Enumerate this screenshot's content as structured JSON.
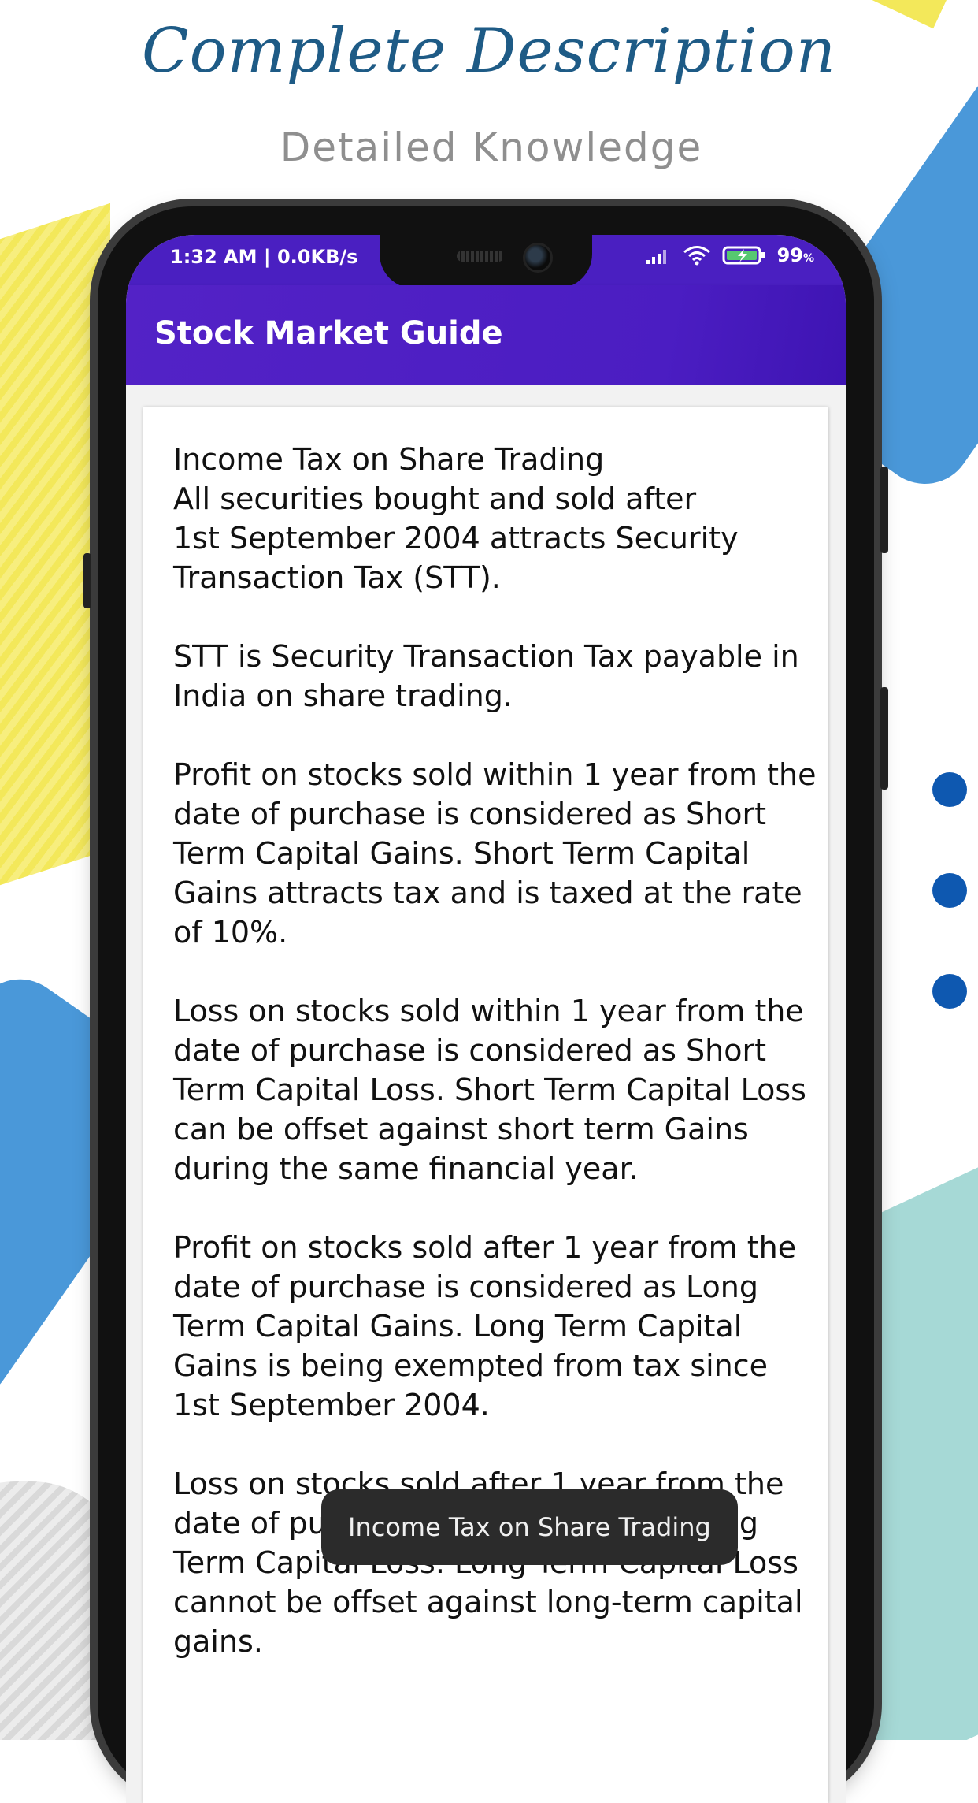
{
  "promo": {
    "headline": "Complete Description",
    "subheadline": "Detailed Knowledge"
  },
  "status_bar": {
    "time": "1:32 AM | 0.0KB/s",
    "battery": "99",
    "battery_unit": "%"
  },
  "app_bar": {
    "title": "Stock Market Guide"
  },
  "article": {
    "paragraphs": [
      "Income Tax on Share Trading\nAll securities bought and sold after\n1st September 2004 attracts Security\nTransaction Tax (STT).",
      "STT is Security Transaction Tax payable in India on share trading.",
      "Profit on stocks sold within 1 year from the date of purchase is considered as Short Term Capital Gains. Short Term Capital Gains attracts tax and is taxed at the rate of 10%.",
      "Loss on stocks sold within 1 year from the date of purchase is considered as Short Term Capital Loss. Short Term Capital Loss can be offset against short term Gains during the same financial year.",
      "Profit on stocks sold after 1 year from the date of purchase is considered as Long Term Capital Gains. Long Term Capital Gains is being exempted from tax since 1st September 2004.",
      "Loss on stocks sold after 1 year from the date of purchase is considered as Long Term Capital Loss. Long Term Capital Loss cannot be offset against long-term capital gains."
    ]
  },
  "toast": {
    "message": "Income Tax on Share Trading"
  },
  "colors": {
    "headline": "#1e5b86",
    "app_bar": "#4b1dc2",
    "dots": "#0e58b0"
  }
}
